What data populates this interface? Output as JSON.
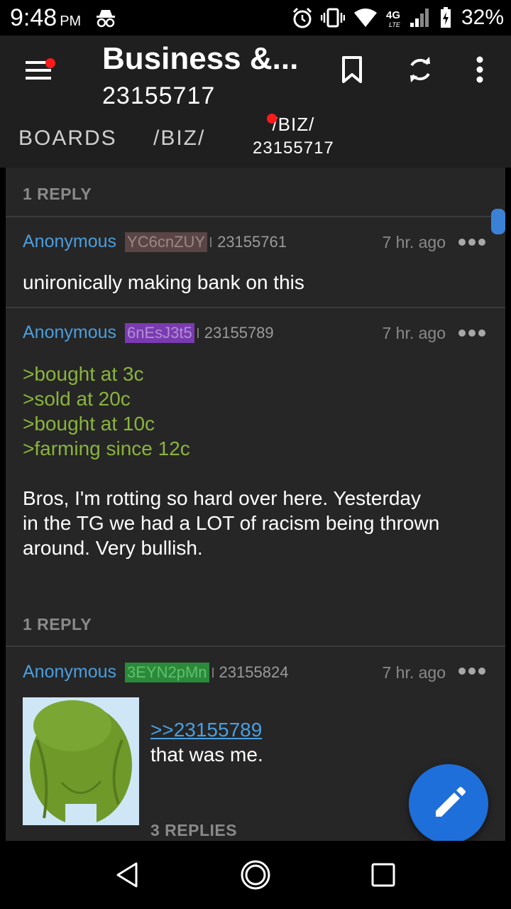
{
  "status_bar": {
    "time": "9:48",
    "ampm": "PM",
    "network": "4G LTE",
    "battery": "32%"
  },
  "app_bar": {
    "title": "Business &...",
    "subtitle": "23155717"
  },
  "tabs": {
    "boards": "BOARDS",
    "board": "/BIZ/",
    "thread_board": "/BIZ/",
    "thread_no": "23155717"
  },
  "thread": {
    "op_reply_count": "1 REPLY",
    "posts": [
      {
        "name": "Anonymous",
        "poster_id": "YC6cnZUY",
        "id_color": "#5a4444",
        "id_text_color": "#9a8888",
        "post_no": "23155761",
        "time": "7 hr. ago",
        "body": "unironically making bank on this"
      },
      {
        "name": "Anonymous",
        "poster_id": "6nEsJ3t5",
        "id_color": "#7a3bb0",
        "id_text_color": "#b38fd6",
        "post_no": "23155789",
        "time": "7 hr. ago",
        "greentext": [
          ">bought at 3c",
          ">sold at 20c",
          ">bought at 10c",
          ">farming since 12c"
        ],
        "body_lines": [
          "Bros, I'm rotting so hard over here. Yesterday",
          "in the TG we had a LOT of racism being thrown",
          "around. Very bullish."
        ],
        "reply_count": "1 REPLY"
      },
      {
        "name": "Anonymous",
        "poster_id": "3EYN2pMn",
        "id_color": "#2a8a3a",
        "id_text_color": "#5fc06d",
        "post_no": "23155824",
        "time": "7 hr. ago",
        "quote": ">>23155789",
        "body": "that was me.",
        "reply_count": "3 REPLIES"
      }
    ]
  },
  "colors": {
    "accent": "#1e6fd9",
    "name": "#4a9fe0",
    "greentext": "#8ab43c",
    "notification": "#ff1a1a"
  },
  "icons": [
    "menu-icon",
    "bookmark-icon",
    "refresh-icon",
    "more-vert-icon",
    "edit-icon",
    "back-icon",
    "home-icon",
    "recents-icon"
  ]
}
